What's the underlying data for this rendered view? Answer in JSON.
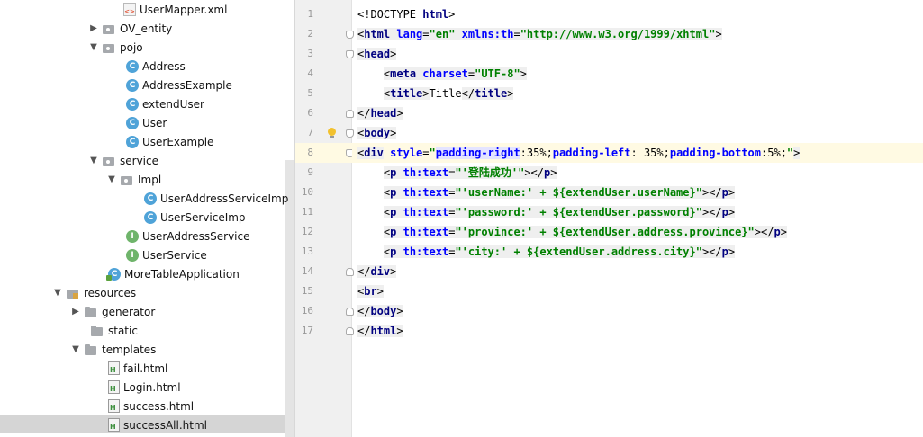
{
  "tree": {
    "items": [
      {
        "label": "UserMapper.xml",
        "icon": "xml-file-icon"
      },
      {
        "label": "OV_entity",
        "icon": "package-icon",
        "arrow": "▶"
      },
      {
        "label": "pojo",
        "icon": "package-icon",
        "arrow": "▼"
      },
      {
        "label": "Address",
        "icon": "class-icon"
      },
      {
        "label": "AddressExample",
        "icon": "class-icon"
      },
      {
        "label": "extendUser",
        "icon": "class-icon"
      },
      {
        "label": "User",
        "icon": "class-icon"
      },
      {
        "label": "UserExample",
        "icon": "class-icon"
      },
      {
        "label": "service",
        "icon": "package-icon",
        "arrow": "▼"
      },
      {
        "label": "Impl",
        "icon": "package-icon",
        "arrow": "▼"
      },
      {
        "label": "UserAddressServiceImp",
        "icon": "class-icon"
      },
      {
        "label": "UserServiceImp",
        "icon": "class-icon"
      },
      {
        "label": "UserAddressService",
        "icon": "interface-icon"
      },
      {
        "label": "UserService",
        "icon": "interface-icon"
      },
      {
        "label": "MoreTableApplication",
        "icon": "spring-app-icon"
      },
      {
        "label": "resources",
        "icon": "resources-folder-icon",
        "arrow": "▼"
      },
      {
        "label": "generator",
        "icon": "folder-icon",
        "arrow": "▶"
      },
      {
        "label": "static",
        "icon": "folder-icon"
      },
      {
        "label": "templates",
        "icon": "folder-icon",
        "arrow": "▼"
      },
      {
        "label": "fail.html",
        "icon": "html-file-icon"
      },
      {
        "label": "Login.html",
        "icon": "html-file-icon"
      },
      {
        "label": "success.html",
        "icon": "html-file-icon"
      },
      {
        "label": "successAll.html",
        "icon": "html-file-icon",
        "selected": true
      }
    ],
    "icon_glyphs": {
      "class": "C",
      "interface": "I",
      "xml": "<>",
      "html": "H"
    }
  },
  "editor": {
    "line_numbers": [
      "1",
      "2",
      "3",
      "4",
      "5",
      "6",
      "7",
      "8",
      "9",
      "10",
      "11",
      "12",
      "13",
      "14",
      "15",
      "16",
      "17"
    ],
    "lines": [
      {
        "p0": "<!DOCTYPE ",
        "t0": "html",
        "p1": ">"
      },
      {
        "p0": "<",
        "t0": "html",
        "s0": " ",
        "a0": "lang",
        "e0": "=",
        "v0": "\"en\"",
        "s1": " ",
        "a1": "xmlns:th",
        "e1": "=",
        "v1": "\"http://www.w3.org/1999/xhtml\"",
        "p1": ">"
      },
      {
        "p0": "<",
        "t0": "head",
        "p1": ">"
      },
      {
        "ind": "    ",
        "p0": "<",
        "t0": "meta",
        "s0": " ",
        "a0": "charset",
        "e0": "=",
        "v0": "\"UTF-8\"",
        "p1": ">"
      },
      {
        "ind": "    ",
        "p0": "<",
        "t0": "title",
        "p1": ">",
        "txt": "Title",
        "p2": "</",
        "t1": "title",
        "p3": ">"
      },
      {
        "p0": "</",
        "t0": "head",
        "p1": ">"
      },
      {
        "p0": "<",
        "t0": "body",
        "p1": ">"
      },
      {
        "p0": "<",
        "t0": "div",
        "s0": " ",
        "a0": "style",
        "e0": "=",
        "q0": "\"",
        "c0": "padding-right",
        "c1": ":35%;",
        "c2": "padding-left",
        "c3": ": 35%;",
        "c4": "padding-bottom",
        "c5": ":5%;",
        "q1": "\"",
        "p1": ">"
      },
      {
        "ind": "    ",
        "p0": "<",
        "t0": "p",
        "s0": " ",
        "a0": "th:text",
        "e0": "=",
        "v0": "\"'登陆成功'\"",
        "p1": "></",
        "t1": "p",
        "p2": ">"
      },
      {
        "ind": "    ",
        "p0": "<",
        "t0": "p",
        "s0": " ",
        "a0": "th:text",
        "e0": "=",
        "v0": "\"'userName:' + ${extendUser.userName}\"",
        "p1": "></",
        "t1": "p",
        "p2": ">"
      },
      {
        "ind": "    ",
        "p0": "<",
        "t0": "p",
        "s0": " ",
        "a0": "th:text",
        "e0": "=",
        "v0": "\"'password:' + ${extendUser.password}\"",
        "p1": "></",
        "t1": "p",
        "p2": ">"
      },
      {
        "ind": "    ",
        "p0": "<",
        "t0": "p",
        "s0": " ",
        "a0": "th:text",
        "e0": "=",
        "v0": "\"'province:' + ${extendUser.address.province}\"",
        "p1": "></",
        "t1": "p",
        "p2": ">"
      },
      {
        "ind": "    ",
        "p0": "<",
        "t0": "p",
        "s0": " ",
        "a0": "th:text",
        "e0": "=",
        "v0": "\"'city:' + ${extendUser.address.city}\"",
        "p1": "></",
        "t1": "p",
        "p2": ">"
      },
      {
        "p0": "</",
        "t0": "div",
        "p1": ">"
      },
      {
        "p0": "<",
        "t0": "br",
        "p1": ">"
      },
      {
        "p0": "</",
        "t0": "body",
        "p1": ">"
      },
      {
        "p0": "</",
        "t0": "html",
        "p1": ">"
      }
    ]
  },
  "colors": {
    "tag": "#000080",
    "attribute": "#0000ff",
    "string": "#008000",
    "current_line": "#fffae3",
    "selection": "#d5d5d5"
  }
}
